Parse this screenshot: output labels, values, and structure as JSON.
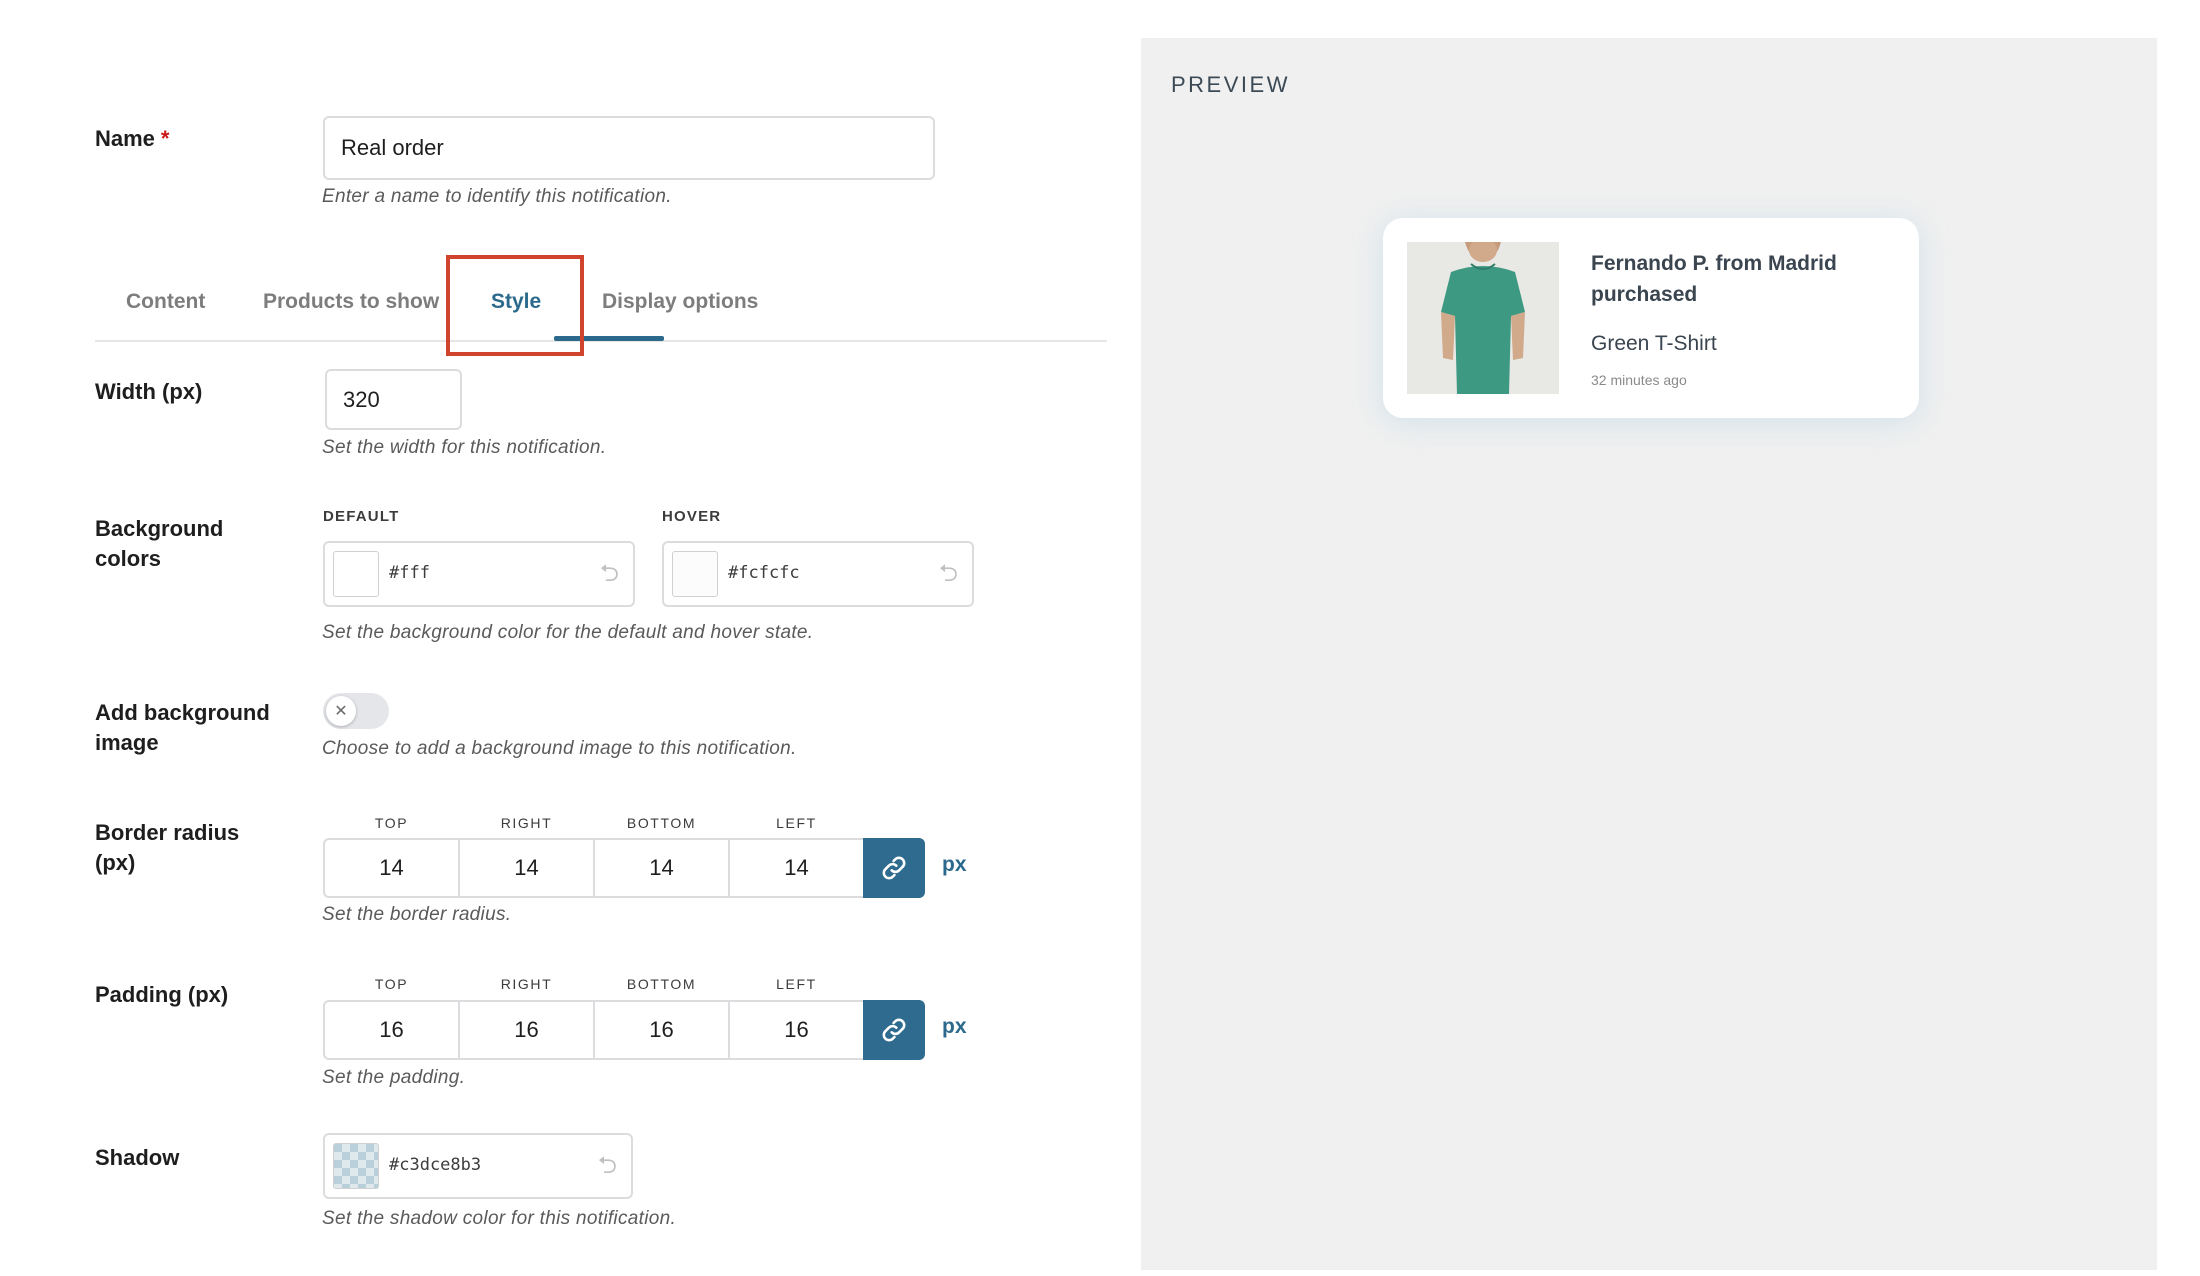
{
  "name_field": {
    "label": "Name",
    "required_mark": "*",
    "value": "Real order",
    "help": "Enter a name to identify this notification."
  },
  "tabs": [
    {
      "label": "Content",
      "active": false
    },
    {
      "label": "Products to show",
      "active": false
    },
    {
      "label": "Style",
      "active": true
    },
    {
      "label": "Display options",
      "active": false
    }
  ],
  "width_field": {
    "label": "Width (px)",
    "value": "320",
    "help": "Set the width for this notification."
  },
  "background_colors": {
    "label_line1": "Background",
    "label_line2": "colors",
    "default_head": "DEFAULT",
    "default_value": "#fff",
    "hover_head": "HOVER",
    "hover_value": "#fcfcfc",
    "help": "Set the background color for the default and hover state."
  },
  "background_image": {
    "label_line1": "Add background",
    "label_line2": "image",
    "enabled": false,
    "toggle_glyph": "✕",
    "help": "Choose to add a background image to this notification."
  },
  "border_radius": {
    "label_line1": "Border radius",
    "label_line2": "(px)",
    "heads": [
      "TOP",
      "RIGHT",
      "BOTTOM",
      "LEFT"
    ],
    "values": [
      "14",
      "14",
      "14",
      "14"
    ],
    "unit": "px",
    "help": "Set the border radius."
  },
  "padding": {
    "label": "Padding (px)",
    "heads": [
      "TOP",
      "RIGHT",
      "BOTTOM",
      "LEFT"
    ],
    "values": [
      "16",
      "16",
      "16",
      "16"
    ],
    "unit": "px",
    "help": "Set the padding."
  },
  "shadow": {
    "label": "Shadow",
    "value": "#c3dce8b3",
    "help": "Set the shadow color for this notification."
  },
  "preview": {
    "title": "PREVIEW",
    "notification": {
      "title": "Fernando P. from Madrid purchased",
      "product": "Green T-Shirt",
      "time": "32 minutes ago"
    }
  },
  "colors": {
    "accent": "#2b6a8c",
    "link_button": "#2e6b8e",
    "highlight": "#d0432c",
    "required": "#cc1818",
    "preview_bg": "#f0f0f0"
  },
  "icons": {
    "reset": "undo-icon",
    "link": "link-icon"
  }
}
